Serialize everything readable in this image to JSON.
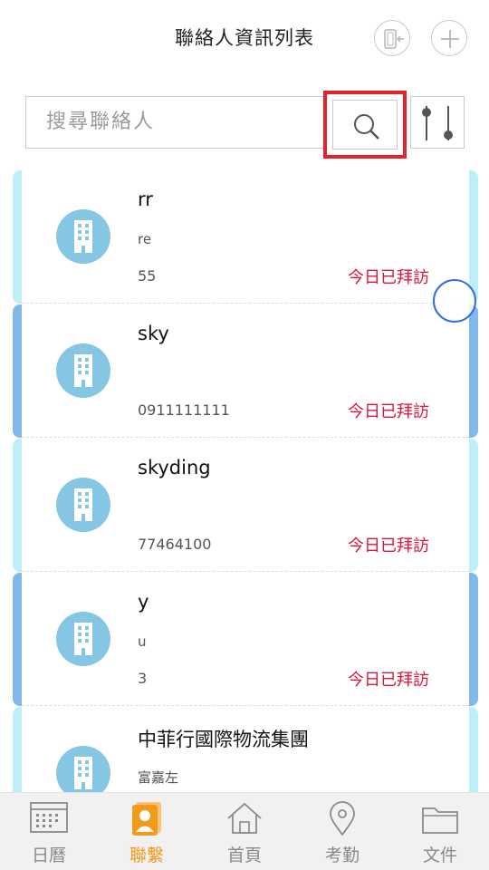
{
  "header": {
    "title": "聯絡人資訊列表",
    "icons": {
      "switch": "phone-switch-icon",
      "add": "plus-icon"
    }
  },
  "search": {
    "placeholder": "搜尋聯絡人",
    "value": "",
    "search_icon": "magnifier-icon",
    "filter_icon": "slider-filter-icon"
  },
  "contacts": [
    {
      "name": "rr",
      "sub": "re",
      "phone": "55",
      "status": "今日已拜訪",
      "style": "light"
    },
    {
      "name": "sky",
      "sub": "",
      "phone": "0911111111",
      "status": "今日已拜訪",
      "style": "dark"
    },
    {
      "name": "skyding",
      "sub": "",
      "phone": "77464100",
      "status": "今日已拜訪",
      "style": "light"
    },
    {
      "name": "y",
      "sub": "u",
      "phone": "3",
      "status": "今日已拜訪",
      "style": "dark"
    },
    {
      "name": "中菲行國際物流集團",
      "sub": "富嘉左",
      "phone": "",
      "status": "",
      "style": "light"
    }
  ],
  "bottom_nav": [
    {
      "label": "日曆",
      "icon": "calendar-icon",
      "active": false
    },
    {
      "label": "聯繫",
      "icon": "contact-card-icon",
      "active": true
    },
    {
      "label": "首頁",
      "icon": "home-icon",
      "active": false
    },
    {
      "label": "考勤",
      "icon": "location-pin-icon",
      "active": false
    },
    {
      "label": "文件",
      "icon": "folder-icon",
      "active": false
    }
  ],
  "colors": {
    "accent": "#f49a1a",
    "status_red": "#e0143c",
    "card_light": "#bdeff8",
    "card_dark": "#80b9ea",
    "avatar": "#86c6e5",
    "highlight": "#e5222c"
  }
}
